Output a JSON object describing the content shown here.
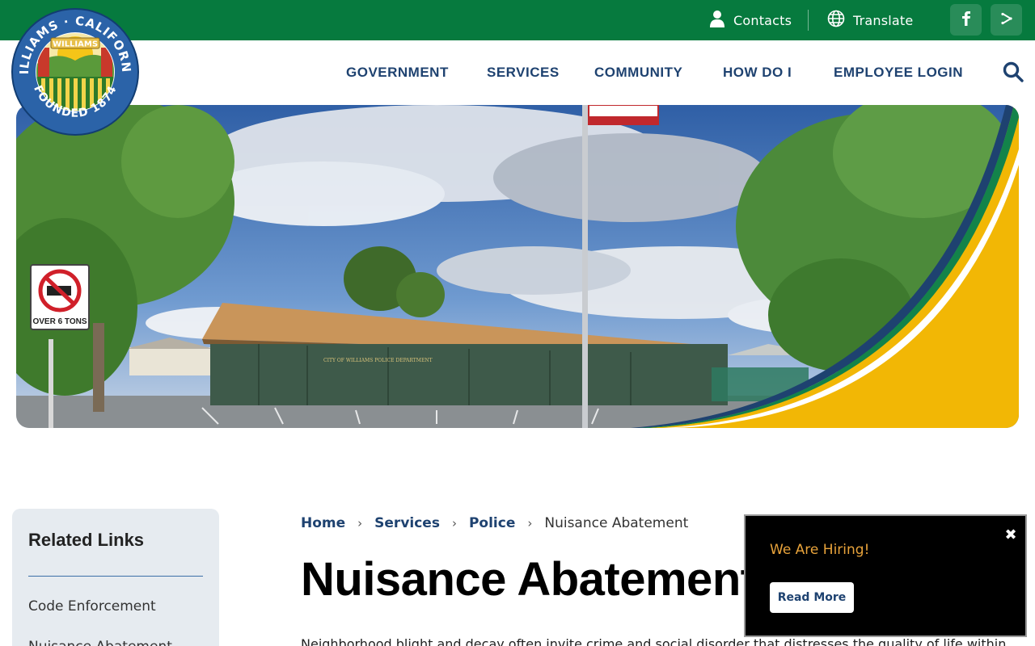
{
  "utility": {
    "contacts_label": "Contacts",
    "translate_label": "Translate",
    "social": [
      {
        "icon": "facebook-icon"
      },
      {
        "icon": "share-icon"
      }
    ]
  },
  "logo": {
    "top_text": "WILLIAMS · CALIFORNIA",
    "banner_text": "WILLIAMS",
    "bottom_text": "FOUNDED 1874"
  },
  "nav": {
    "items": [
      "GOVERNMENT",
      "SERVICES",
      "COMMUNITY",
      "HOW DO I",
      "EMPLOYEE LOGIN"
    ],
    "search_icon": "search-icon"
  },
  "hero": {
    "building_sign": "CITY OF WILLIAMS POLICE DEPARTMENT",
    "street_sign": "OVER 6 TONS"
  },
  "sidebar": {
    "title": "Related Links",
    "links": [
      "Code Enforcement",
      "Nuisance Abatement"
    ]
  },
  "breadcrumb": {
    "items": [
      "Home",
      "Services",
      "Police"
    ],
    "current": "Nuisance Abatement"
  },
  "page": {
    "title": "Nuisance Abatement",
    "intro": "Neighborhood blight and decay often invite crime and social disorder that distresses the quality of life within"
  },
  "popup": {
    "title": "We Are Hiring!",
    "button": "Read More",
    "close_icon": "close-icon"
  },
  "colors": {
    "brand_green": "#067a3e",
    "nav_blue": "#1e4270",
    "accent_gold": "#f2b705",
    "popup_title": "#e8a33b"
  }
}
